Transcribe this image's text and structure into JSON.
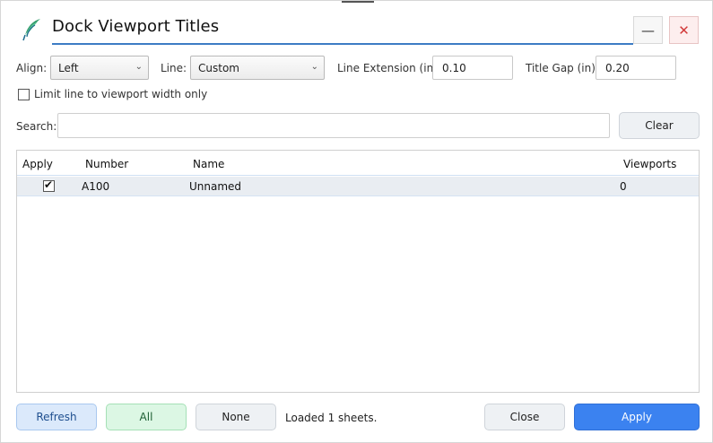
{
  "window": {
    "title": "Dock Viewport Titles",
    "minimize_glyph": "—",
    "close_glyph": "✕"
  },
  "options": {
    "align_label": "Align:",
    "align_value": "Left",
    "line_label": "Line:",
    "line_value": "Custom",
    "line_extension_label": "Line Extension (in):",
    "line_extension_value": "0.10",
    "title_gap_label": "Title Gap (in):",
    "title_gap_value": "0.20",
    "limit_checkbox_label": "Limit line to viewport width only",
    "limit_checked": false
  },
  "search": {
    "label": "Search:",
    "value": "",
    "clear_label": "Clear"
  },
  "table": {
    "columns": [
      "Apply",
      "Number",
      "Name",
      "Viewports"
    ],
    "rows": [
      {
        "apply": true,
        "number": "A100",
        "name": "Unnamed",
        "viewports": "0"
      }
    ]
  },
  "footer": {
    "refresh_label": "Refresh",
    "all_label": "All",
    "none_label": "None",
    "status_text": "Loaded 1 sheets.",
    "close_label": "Close",
    "apply_label": "Apply"
  },
  "colors": {
    "accent": "#3d7cc4",
    "apply_button": "#3b82f0",
    "refresh_button": "#dbe9fb",
    "all_button": "#dcf7e4",
    "close_hover": "#fdeeee"
  },
  "icons": {
    "logo": "feather-logo-icon",
    "dropdown": "chevron-down-icon",
    "check": "checkmark-icon"
  }
}
